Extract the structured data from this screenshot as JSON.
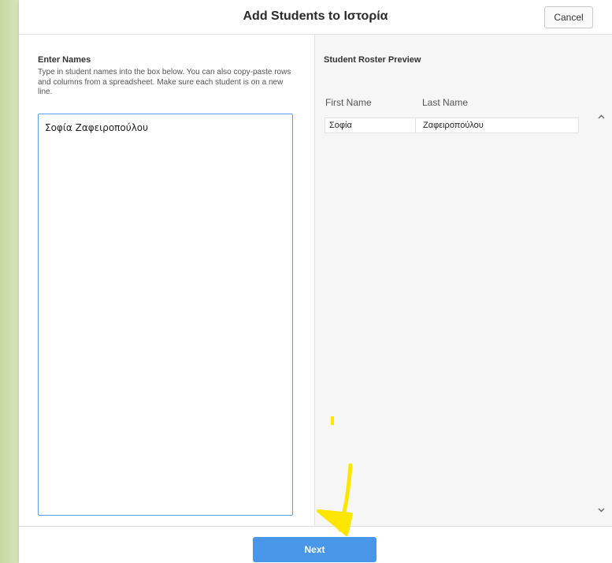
{
  "dialog": {
    "title": "Add Students to Ιστορία",
    "cancel_label": "Cancel"
  },
  "enter_names": {
    "heading": "Enter Names",
    "instructions": "Type in student names into the box below. You can also copy-paste rows and columns from a spreadsheet. Make sure each student is on a new line.",
    "value": "Σοφία Ζαφειροπούλου"
  },
  "preview": {
    "heading": "Student Roster Preview",
    "columns": [
      "First Name",
      "Last Name"
    ],
    "rows": [
      {
        "first": "Σοφία",
        "last": "Ζαφειροπούλου"
      }
    ]
  },
  "footer": {
    "next_label": "Next"
  },
  "colors": {
    "accent": "#4a97ea",
    "annotation": "#ffe600",
    "background": "#e4efcf"
  },
  "icons": {
    "scroll_up": "chevron-up-icon",
    "scroll_down": "chevron-down-icon"
  }
}
